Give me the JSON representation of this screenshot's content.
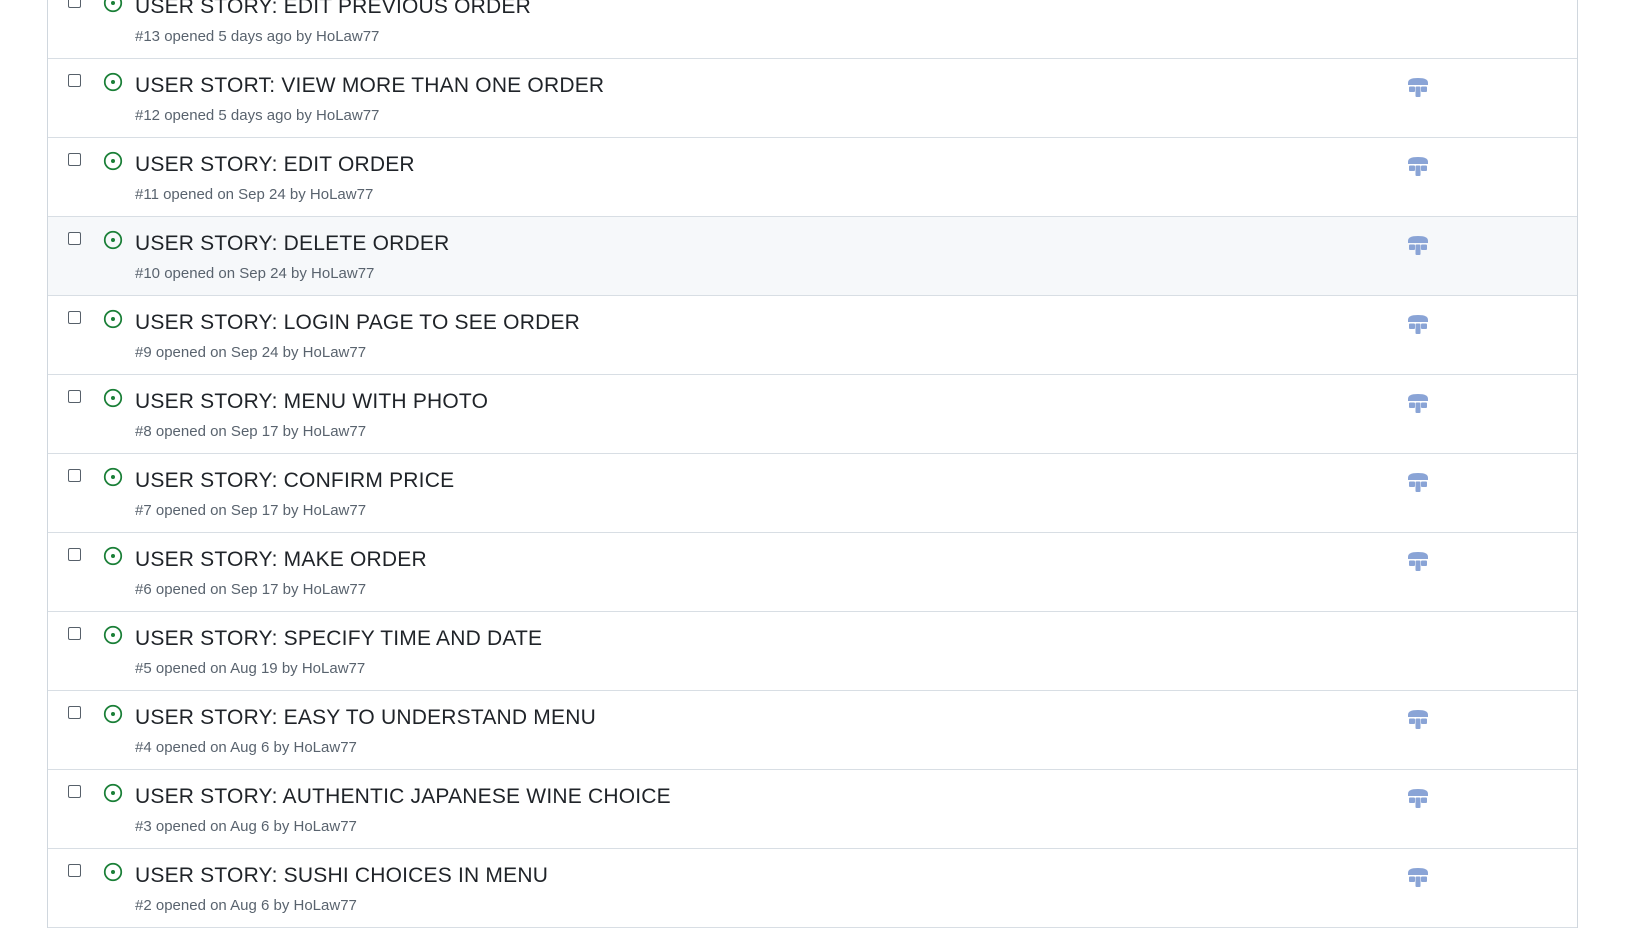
{
  "issues": [
    {
      "title": "USER STORY: EDIT PREVIOUS ORDER",
      "number": "#13",
      "opened": "opened 5 days ago",
      "by": "by",
      "author": "HoLaw77",
      "has_project_icon": false,
      "hovered": false
    },
    {
      "title": "USER STORT: VIEW MORE THAN ONE ORDER",
      "number": "#12",
      "opened": "opened 5 days ago",
      "by": "by",
      "author": "HoLaw77",
      "has_project_icon": true,
      "hovered": false
    },
    {
      "title": "USER STORY: EDIT ORDER",
      "number": "#11",
      "opened": "opened on Sep 24",
      "by": "by",
      "author": "HoLaw77",
      "has_project_icon": true,
      "hovered": false
    },
    {
      "title": "USER STORY: DELETE ORDER",
      "number": "#10",
      "opened": "opened on Sep 24",
      "by": "by",
      "author": "HoLaw77",
      "has_project_icon": true,
      "hovered": true
    },
    {
      "title": "USER STORY: LOGIN PAGE TO SEE ORDER",
      "number": "#9",
      "opened": "opened on Sep 24",
      "by": "by",
      "author": "HoLaw77",
      "has_project_icon": true,
      "hovered": false
    },
    {
      "title": "USER STORY: MENU WITH PHOTO",
      "number": "#8",
      "opened": "opened on Sep 17",
      "by": "by",
      "author": "HoLaw77",
      "has_project_icon": true,
      "hovered": false
    },
    {
      "title": "USER STORY: CONFIRM PRICE",
      "number": "#7",
      "opened": "opened on Sep 17",
      "by": "by",
      "author": "HoLaw77",
      "has_project_icon": true,
      "hovered": false
    },
    {
      "title": "USER STORY: MAKE ORDER",
      "number": "#6",
      "opened": "opened on Sep 17",
      "by": "by",
      "author": "HoLaw77",
      "has_project_icon": true,
      "hovered": false
    },
    {
      "title": "USER STORY: SPECIFY TIME AND DATE",
      "number": "#5",
      "opened": "opened on Aug 19",
      "by": "by",
      "author": "HoLaw77",
      "has_project_icon": false,
      "hovered": false
    },
    {
      "title": "USER STORY: EASY TO UNDERSTAND MENU",
      "number": "#4",
      "opened": "opened on Aug 6",
      "by": "by",
      "author": "HoLaw77",
      "has_project_icon": true,
      "hovered": false
    },
    {
      "title": "USER STORY: AUTHENTIC JAPANESE WINE CHOICE",
      "number": "#3",
      "opened": "opened on Aug 6",
      "by": "by",
      "author": "HoLaw77",
      "has_project_icon": true,
      "hovered": false
    },
    {
      "title": "USER STORY: SUSHI CHOICES IN MENU",
      "number": "#2",
      "opened": "opened on Aug 6",
      "by": "by",
      "author": "HoLaw77",
      "has_project_icon": true,
      "hovered": false
    }
  ],
  "icons": {
    "open_issue": "issue-opened-icon",
    "linked": "project-board-icon"
  },
  "colors": {
    "open_green": "#1a7f37",
    "icon_blue": "#8aa4d6",
    "title_text": "#1f2328",
    "meta_text": "#59636e",
    "hover_bg": "#f6f8fa"
  }
}
